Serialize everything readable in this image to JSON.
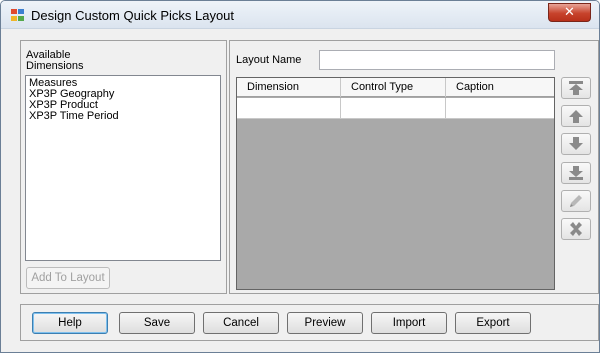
{
  "window": {
    "title": "Design Custom Quick Picks Layout",
    "close_glyph": "✕"
  },
  "left_panel": {
    "label_line1": "Available",
    "label_line2": "Dimensions",
    "dimensions": [
      "Measures",
      "XP3P Geography",
      "XP3P Product",
      "XP3P Time Period"
    ],
    "add_button": "Add To Layout"
  },
  "right_panel": {
    "layout_name_label": "Layout Name",
    "layout_name_value": "",
    "columns": [
      "Dimension",
      "Control Type",
      "Caption"
    ],
    "side_buttons": [
      "move-top-icon",
      "move-up-icon",
      "move-down-icon",
      "move-bottom-icon",
      "edit-icon",
      "delete-icon"
    ]
  },
  "footer": {
    "help": "Help",
    "save": "Save",
    "cancel": "Cancel",
    "preview": "Preview",
    "import": "Import",
    "export": "Export"
  },
  "colors": {
    "grid_background": "#a9a9a9",
    "close_button": "#c7432c",
    "default_button_border": "#3c7fb1"
  }
}
